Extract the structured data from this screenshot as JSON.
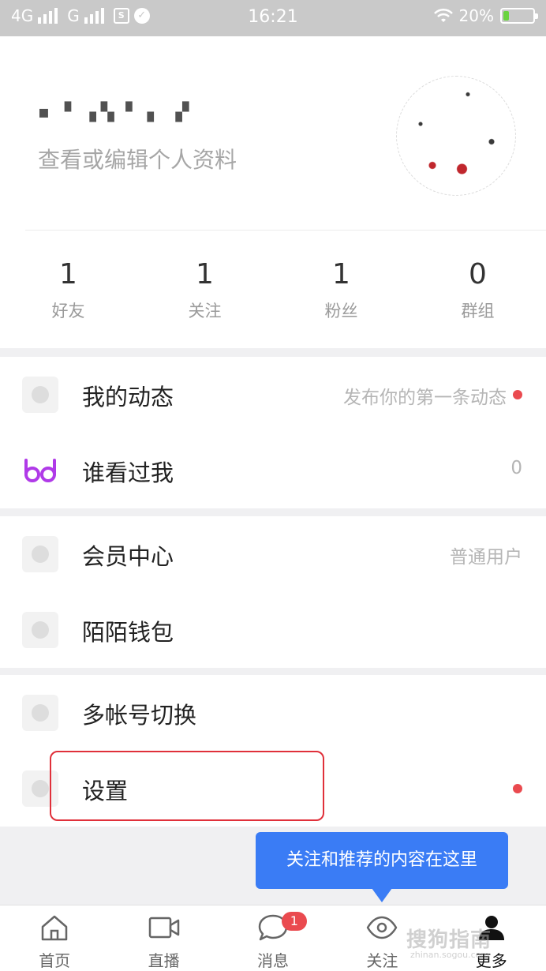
{
  "status_bar": {
    "network_1": "4G",
    "network_2": "G",
    "time": "16:21",
    "battery": "20%",
    "battery_level_percent": 20
  },
  "profile": {
    "subtitle": "查看或编辑个人资料",
    "stats": [
      {
        "value": "1",
        "label": "好友"
      },
      {
        "value": "1",
        "label": "关注"
      },
      {
        "value": "1",
        "label": "粉丝"
      },
      {
        "value": "0",
        "label": "群组"
      }
    ]
  },
  "menu": {
    "group1": [
      {
        "label": "我的动态",
        "detail": "发布你的第一条动态",
        "dot": true
      },
      {
        "label": "谁看过我",
        "detail": "0"
      }
    ],
    "group2": [
      {
        "label": "会员中心",
        "detail": "普通用户"
      },
      {
        "label": "陌陌钱包"
      }
    ],
    "group3": [
      {
        "label": "多帐号切换"
      },
      {
        "label": "设置",
        "dot": true
      }
    ]
  },
  "tooltip": "关注和推荐的内容在这里",
  "bottom_nav": [
    {
      "label": "首页",
      "icon": "home-icon"
    },
    {
      "label": "直播",
      "icon": "video-camera-icon"
    },
    {
      "label": "消息",
      "icon": "chat-bubble-icon",
      "badge": "1"
    },
    {
      "label": "关注",
      "icon": "eye-icon"
    },
    {
      "label": "更多",
      "icon": "person-icon",
      "active": true
    }
  ],
  "watermark": "搜狗指南",
  "watermark_sub": "zhinan.sogou.com",
  "colors": {
    "accent_red": "#ea4a4f",
    "tooltip_blue": "#3a7cf5",
    "glasses_purple": "#b03ae8"
  }
}
